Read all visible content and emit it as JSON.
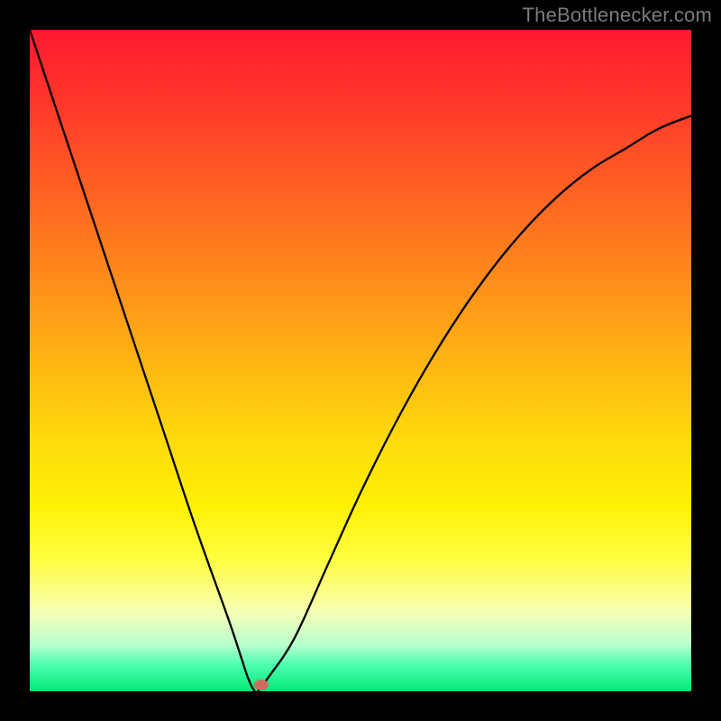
{
  "attribution": "TheBottlenecker.com",
  "chart_data": {
    "type": "line",
    "title": "",
    "xlabel": "",
    "ylabel": "",
    "xlim": [
      0,
      100
    ],
    "ylim": [
      0,
      100
    ],
    "series": [
      {
        "name": "bottleneck-curve",
        "x": [
          0,
          5,
          10,
          15,
          20,
          25,
          30,
          32,
          33,
          34,
          34.5,
          36,
          40,
          45,
          50,
          55,
          60,
          65,
          70,
          75,
          80,
          85,
          90,
          95,
          100
        ],
        "values": [
          100,
          85,
          70,
          55,
          40,
          25,
          11,
          5,
          2,
          0,
          0,
          2,
          8,
          19,
          30,
          40,
          49,
          57,
          64,
          70,
          75,
          79,
          82,
          85,
          87
        ]
      }
    ],
    "marker": {
      "x": 35,
      "y": 0,
      "name": "optimal-point"
    },
    "background_gradient": {
      "top": "#ff1a30",
      "mid": "#ffe100",
      "bottom": "#00e874"
    }
  }
}
